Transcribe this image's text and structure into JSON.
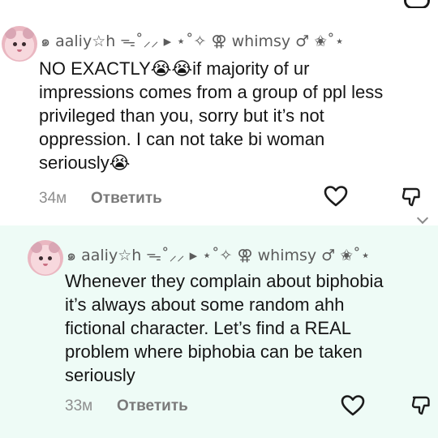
{
  "comments": [
    {
      "username": "๑ aaliy☆h ᯓ˚⸝⸝ ▸ ⋆˚✧ ⚢ whimsy ♂ ✬˚⋆",
      "text": "NO EXACTLY😭😭if majority of ur\nimpressions comes from a group of ppl less\nprivileged than you, sorry but it’s not\noppression. I can not take bi woman\nseriously😭",
      "time": "34м",
      "reply_label": "Ответить"
    },
    {
      "username": "๑ aaliy☆h ᯓ˚⸝⸝ ▸ ⋆˚✧ ⚢ whimsy ♂ ✬˚⋆",
      "text": "Whenever they complain about biphobia\nit’s always about some random ahh\nfictional character. Let’s find a REAL\nproblem where biphobia can be taken\nseriously",
      "time": "33м",
      "reply_label": "Ответить"
    }
  ],
  "icons": {
    "like": "heart-outline-icon",
    "dislike": "thumbs-down-outline-icon",
    "expand": "chevron-down-icon"
  },
  "colors": {
    "reply_background": "#eefbf6",
    "muted_text": "#8e8e8e"
  }
}
